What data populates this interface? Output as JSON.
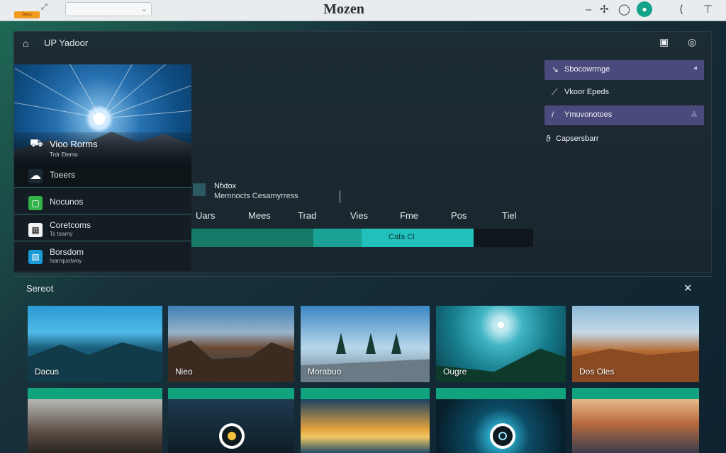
{
  "topbar": {
    "tab_label": "Daxc",
    "app_title": "Mozen",
    "icons": [
      "expand-icon",
      "minimize-icon",
      "pin-icon",
      "circle-icon",
      "teal-dot-icon",
      "back-icon",
      "pin-down-icon"
    ]
  },
  "panel": {
    "title": "UP Yadoor"
  },
  "hero": {
    "title": "Vioo Rorms",
    "subtitle": "Trdr Etemo"
  },
  "side_list": [
    {
      "label": "Toeers",
      "sub": "",
      "icon": "cloud-icon",
      "color": "#1b2a32"
    },
    {
      "label": "Nocunos",
      "sub": "",
      "icon": "green-app-icon",
      "color": "#33b249"
    },
    {
      "label": "Coretcoms",
      "sub": "Ts toarny",
      "icon": "qr-icon",
      "color": "#f3f5f6"
    },
    {
      "label": "Borsdom",
      "sub": "Isarrquolwoy",
      "icon": "blue-app-icon",
      "color": "#1a9ad6"
    }
  ],
  "center": {
    "title": "Nfxtox",
    "subtitle": "Memnocts Cesamyrress",
    "columns": [
      "Uars",
      "Mees",
      "Trad",
      "Vies",
      "Fme",
      "Pos",
      "Tiel"
    ],
    "progress_label": "Cafa Cl",
    "progress_segments_percent": [
      35.7,
      14.1,
      32.8
    ]
  },
  "right_menu": [
    {
      "label": "Sbocowrmge",
      "icon": "bird-icon",
      "selected": true
    },
    {
      "label": "Vkoor Epeds",
      "icon": "pen-icon",
      "selected": false
    },
    {
      "label": "Ymuvonotoes",
      "icon": "slash-icon",
      "selected": true
    },
    {
      "label": "Capsersbarr",
      "icon": "link-icon",
      "selected": false
    }
  ],
  "gallery": {
    "title": "Sereot",
    "tiles_top": [
      "Dacus",
      "Nieo",
      "Morabuo",
      "Ougre",
      "Dos Oles"
    ]
  }
}
